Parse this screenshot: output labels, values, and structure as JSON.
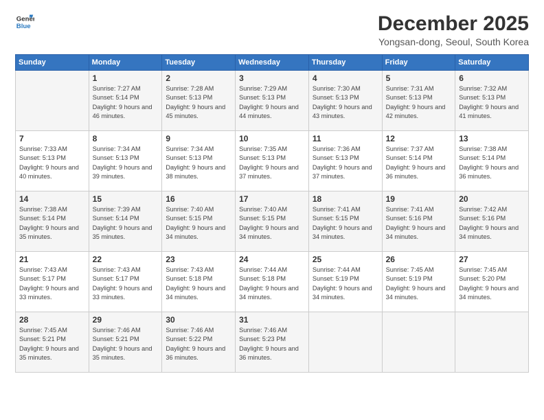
{
  "logo": {
    "line1": "General",
    "line2": "Blue"
  },
  "title": "December 2025",
  "subtitle": "Yongsan-dong, Seoul, South Korea",
  "days_of_week": [
    "Sunday",
    "Monday",
    "Tuesday",
    "Wednesday",
    "Thursday",
    "Friday",
    "Saturday"
  ],
  "weeks": [
    [
      {
        "num": "",
        "sunrise": "",
        "sunset": "",
        "daylight": ""
      },
      {
        "num": "1",
        "sunrise": "Sunrise: 7:27 AM",
        "sunset": "Sunset: 5:14 PM",
        "daylight": "Daylight: 9 hours and 46 minutes."
      },
      {
        "num": "2",
        "sunrise": "Sunrise: 7:28 AM",
        "sunset": "Sunset: 5:13 PM",
        "daylight": "Daylight: 9 hours and 45 minutes."
      },
      {
        "num": "3",
        "sunrise": "Sunrise: 7:29 AM",
        "sunset": "Sunset: 5:13 PM",
        "daylight": "Daylight: 9 hours and 44 minutes."
      },
      {
        "num": "4",
        "sunrise": "Sunrise: 7:30 AM",
        "sunset": "Sunset: 5:13 PM",
        "daylight": "Daylight: 9 hours and 43 minutes."
      },
      {
        "num": "5",
        "sunrise": "Sunrise: 7:31 AM",
        "sunset": "Sunset: 5:13 PM",
        "daylight": "Daylight: 9 hours and 42 minutes."
      },
      {
        "num": "6",
        "sunrise": "Sunrise: 7:32 AM",
        "sunset": "Sunset: 5:13 PM",
        "daylight": "Daylight: 9 hours and 41 minutes."
      }
    ],
    [
      {
        "num": "7",
        "sunrise": "Sunrise: 7:33 AM",
        "sunset": "Sunset: 5:13 PM",
        "daylight": "Daylight: 9 hours and 40 minutes."
      },
      {
        "num": "8",
        "sunrise": "Sunrise: 7:34 AM",
        "sunset": "Sunset: 5:13 PM",
        "daylight": "Daylight: 9 hours and 39 minutes."
      },
      {
        "num": "9",
        "sunrise": "Sunrise: 7:34 AM",
        "sunset": "Sunset: 5:13 PM",
        "daylight": "Daylight: 9 hours and 38 minutes."
      },
      {
        "num": "10",
        "sunrise": "Sunrise: 7:35 AM",
        "sunset": "Sunset: 5:13 PM",
        "daylight": "Daylight: 9 hours and 37 minutes."
      },
      {
        "num": "11",
        "sunrise": "Sunrise: 7:36 AM",
        "sunset": "Sunset: 5:13 PM",
        "daylight": "Daylight: 9 hours and 37 minutes."
      },
      {
        "num": "12",
        "sunrise": "Sunrise: 7:37 AM",
        "sunset": "Sunset: 5:14 PM",
        "daylight": "Daylight: 9 hours and 36 minutes."
      },
      {
        "num": "13",
        "sunrise": "Sunrise: 7:38 AM",
        "sunset": "Sunset: 5:14 PM",
        "daylight": "Daylight: 9 hours and 36 minutes."
      }
    ],
    [
      {
        "num": "14",
        "sunrise": "Sunrise: 7:38 AM",
        "sunset": "Sunset: 5:14 PM",
        "daylight": "Daylight: 9 hours and 35 minutes."
      },
      {
        "num": "15",
        "sunrise": "Sunrise: 7:39 AM",
        "sunset": "Sunset: 5:14 PM",
        "daylight": "Daylight: 9 hours and 35 minutes."
      },
      {
        "num": "16",
        "sunrise": "Sunrise: 7:40 AM",
        "sunset": "Sunset: 5:15 PM",
        "daylight": "Daylight: 9 hours and 34 minutes."
      },
      {
        "num": "17",
        "sunrise": "Sunrise: 7:40 AM",
        "sunset": "Sunset: 5:15 PM",
        "daylight": "Daylight: 9 hours and 34 minutes."
      },
      {
        "num": "18",
        "sunrise": "Sunrise: 7:41 AM",
        "sunset": "Sunset: 5:15 PM",
        "daylight": "Daylight: 9 hours and 34 minutes."
      },
      {
        "num": "19",
        "sunrise": "Sunrise: 7:41 AM",
        "sunset": "Sunset: 5:16 PM",
        "daylight": "Daylight: 9 hours and 34 minutes."
      },
      {
        "num": "20",
        "sunrise": "Sunrise: 7:42 AM",
        "sunset": "Sunset: 5:16 PM",
        "daylight": "Daylight: 9 hours and 34 minutes."
      }
    ],
    [
      {
        "num": "21",
        "sunrise": "Sunrise: 7:43 AM",
        "sunset": "Sunset: 5:17 PM",
        "daylight": "Daylight: 9 hours and 33 minutes."
      },
      {
        "num": "22",
        "sunrise": "Sunrise: 7:43 AM",
        "sunset": "Sunset: 5:17 PM",
        "daylight": "Daylight: 9 hours and 33 minutes."
      },
      {
        "num": "23",
        "sunrise": "Sunrise: 7:43 AM",
        "sunset": "Sunset: 5:18 PM",
        "daylight": "Daylight: 9 hours and 34 minutes."
      },
      {
        "num": "24",
        "sunrise": "Sunrise: 7:44 AM",
        "sunset": "Sunset: 5:18 PM",
        "daylight": "Daylight: 9 hours and 34 minutes."
      },
      {
        "num": "25",
        "sunrise": "Sunrise: 7:44 AM",
        "sunset": "Sunset: 5:19 PM",
        "daylight": "Daylight: 9 hours and 34 minutes."
      },
      {
        "num": "26",
        "sunrise": "Sunrise: 7:45 AM",
        "sunset": "Sunset: 5:19 PM",
        "daylight": "Daylight: 9 hours and 34 minutes."
      },
      {
        "num": "27",
        "sunrise": "Sunrise: 7:45 AM",
        "sunset": "Sunset: 5:20 PM",
        "daylight": "Daylight: 9 hours and 34 minutes."
      }
    ],
    [
      {
        "num": "28",
        "sunrise": "Sunrise: 7:45 AM",
        "sunset": "Sunset: 5:21 PM",
        "daylight": "Daylight: 9 hours and 35 minutes."
      },
      {
        "num": "29",
        "sunrise": "Sunrise: 7:46 AM",
        "sunset": "Sunset: 5:21 PM",
        "daylight": "Daylight: 9 hours and 35 minutes."
      },
      {
        "num": "30",
        "sunrise": "Sunrise: 7:46 AM",
        "sunset": "Sunset: 5:22 PM",
        "daylight": "Daylight: 9 hours and 36 minutes."
      },
      {
        "num": "31",
        "sunrise": "Sunrise: 7:46 AM",
        "sunset": "Sunset: 5:23 PM",
        "daylight": "Daylight: 9 hours and 36 minutes."
      },
      {
        "num": "",
        "sunrise": "",
        "sunset": "",
        "daylight": ""
      },
      {
        "num": "",
        "sunrise": "",
        "sunset": "",
        "daylight": ""
      },
      {
        "num": "",
        "sunrise": "",
        "sunset": "",
        "daylight": ""
      }
    ]
  ]
}
